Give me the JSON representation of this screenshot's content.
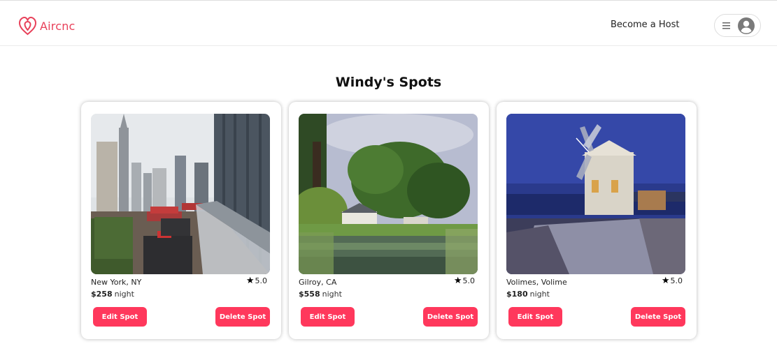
{
  "header": {
    "logo_text": "Aircnc",
    "host_link": "Become a Host",
    "brand_color": "#ff385c",
    "icons": [
      "airbnb-logo-icon",
      "hamburger-menu-icon",
      "user-avatar-icon"
    ]
  },
  "page": {
    "title": "Windy's Spots"
  },
  "spots": [
    {
      "location": "New York, NY",
      "rating": "5.0",
      "price": "$258",
      "price_unit": "night",
      "edit_label": "Edit Spot",
      "delete_label": "Delete Spot"
    },
    {
      "location": "Gilroy, CA",
      "rating": "5.0",
      "price": "$558",
      "price_unit": "night",
      "edit_label": "Edit Spot",
      "delete_label": "Delete Spot"
    },
    {
      "location": "Volimes, Volime",
      "rating": "5.0",
      "price": "$180",
      "price_unit": "night",
      "edit_label": "Edit Spot",
      "delete_label": "Delete Spot"
    }
  ]
}
